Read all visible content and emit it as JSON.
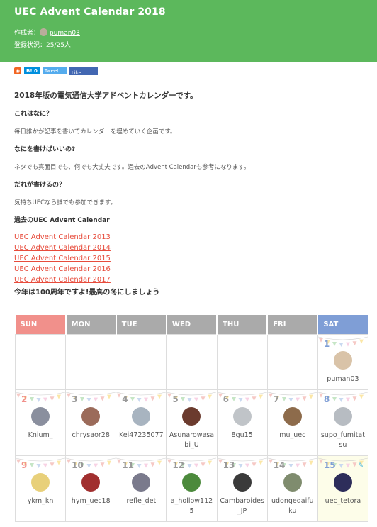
{
  "header": {
    "title": "UEC Advent Calendar 2018",
    "author_label": "作成者：",
    "author_name": "puman03",
    "status": "登録状況：25/25人"
  },
  "share": {
    "hatena": "B! 0",
    "tweet": "Tweet",
    "like": "Like"
  },
  "intro": "2018年版の電気通信大学アドベントカレンダーです。",
  "faq": [
    {
      "q": "これはなに？",
      "a": "毎日誰かが記事を書いてカレンダーを埋めていく企画です。"
    },
    {
      "q": "なにを書けばいいの?",
      "a": "ネタでも真面目でも、何でも大丈夫です。過去のAdvent Calendarも参考になります。"
    },
    {
      "q": "だれが書けるの？",
      "a": "気持ちUECなら誰でも参加できます。"
    }
  ],
  "past_heading": "過去のUEC Advent Calendar",
  "past_links": [
    "UEC Advent Calendar 2013",
    "UEC Advent Calendar 2014",
    "UEC Advent Calendar 2015",
    "UEC Advent Calendar 2016",
    "UEC Advent Calendar 2017"
  ],
  "closing": "今年は100周年ですよ!最高の冬にしましょう",
  "calendar": {
    "days": [
      "SUN",
      "MON",
      "TUE",
      "WED",
      "THU",
      "FRI",
      "SAT"
    ],
    "colors": {
      "sun": "#f1908b",
      "weekday": "#aaaaaa",
      "sat": "#7f9ed6",
      "link": "#e74c3c",
      "header": "#5cb85c"
    },
    "weeks": [
      [
        null,
        null,
        null,
        null,
        null,
        null,
        {
          "day": "1",
          "user": "puman03"
        }
      ],
      [
        {
          "day": "2",
          "user": "Knium_"
        },
        {
          "day": "3",
          "user": "chrysaor28"
        },
        {
          "day": "4",
          "user": "Kei47235077"
        },
        {
          "day": "5",
          "user": "Asunarowasabi_U"
        },
        {
          "day": "6",
          "user": "8gu15"
        },
        {
          "day": "7",
          "user": "mu_uec"
        },
        {
          "day": "8",
          "user": "supo_fumitatsu"
        }
      ],
      [
        {
          "day": "9",
          "user": "ykm_kn"
        },
        {
          "day": "10",
          "user": "hym_uec18"
        },
        {
          "day": "11",
          "user": "refle_det"
        },
        {
          "day": "12",
          "user": "a_hollow1125"
        },
        {
          "day": "13",
          "user": "Cambaroides_JP"
        },
        {
          "day": "14",
          "user": "udongedaifuku"
        },
        {
          "day": "15",
          "user": "uec_tetora"
        }
      ]
    ]
  }
}
